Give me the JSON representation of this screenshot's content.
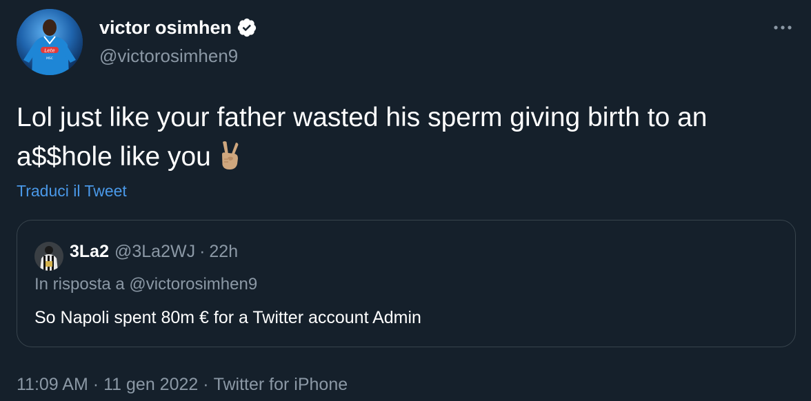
{
  "tweet": {
    "author": {
      "name": "victor osimhen",
      "handle": "@victorosimhen9",
      "avatar_icon": "player-avatar",
      "verified_icon": "verified-badge-icon"
    },
    "more_icon": "more-options-icon",
    "text": "Lol just like your father wasted his sperm giving birth to an a$$hole like you",
    "emoji": "✌🏼",
    "translate_label": "Traduci il Tweet",
    "meta": {
      "time": "11:09 AM",
      "date": "11 gen 2022",
      "source": "Twitter for iPhone",
      "separator": "·"
    }
  },
  "quote": {
    "name": "3La2",
    "handle": "@3La2WJ",
    "separator": "·",
    "time": "22h",
    "reply_to": "In risposta a @victorosimhen9",
    "text": "So Napoli spent 80m € for a Twitter account Admin"
  },
  "colors": {
    "background": "#15202b",
    "secondary_text": "#8b98a5",
    "link": "#4a99e9",
    "border": "#38444d",
    "verified": "#ffffff"
  }
}
